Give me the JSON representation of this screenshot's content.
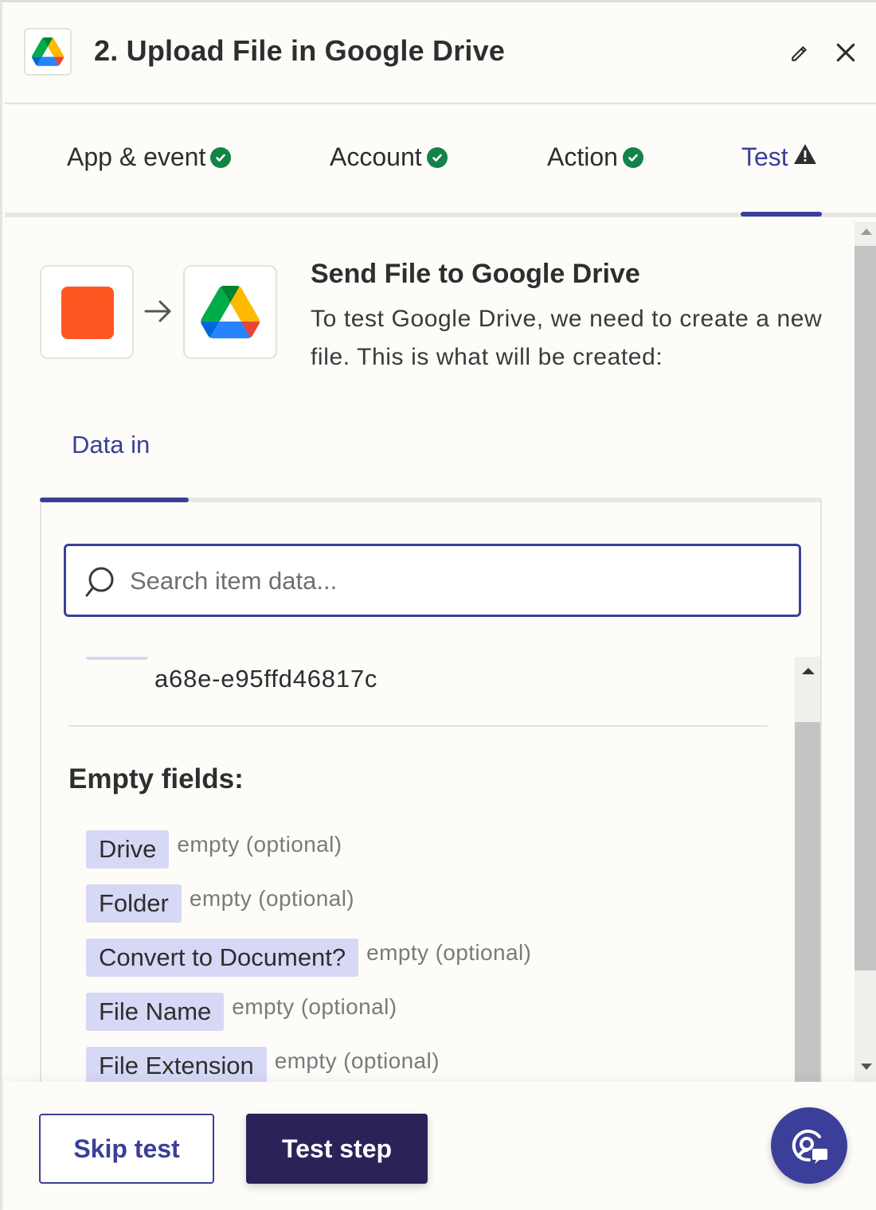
{
  "header": {
    "title": "2. Upload File in Google Drive",
    "app_icon": "google-drive-icon",
    "edit_icon": "pencil-icon",
    "close_icon": "close-icon"
  },
  "steps": [
    {
      "label": "App & event",
      "status": "complete"
    },
    {
      "label": "Account",
      "status": "complete"
    },
    {
      "label": "Action",
      "status": "complete"
    },
    {
      "label": "Test",
      "status": "warning",
      "active": true
    }
  ],
  "flow": {
    "title": "Send File to Google Drive",
    "description": "To test Google Drive, we need to create a new file. This is what will be created:",
    "source_color": "#ff5722"
  },
  "data_tab": {
    "label": "Data in"
  },
  "search": {
    "placeholder": "Search item data..."
  },
  "list": {
    "partial_value": "a68e-e95ffd46817c",
    "empty_heading": "Empty fields:",
    "empty_fields": [
      {
        "name": "Drive",
        "note": "empty (optional)"
      },
      {
        "name": "Folder",
        "note": "empty (optional)"
      },
      {
        "name": "Convert to Document?",
        "note": "empty (optional)"
      },
      {
        "name": "File Name",
        "note": "empty (optional)"
      },
      {
        "name": "File Extension",
        "note": "empty (optional)"
      }
    ]
  },
  "footer": {
    "skip_label": "Skip test",
    "test_label": "Test step",
    "help_icon": "support-chat-icon"
  },
  "colors": {
    "accent": "#3b3f99",
    "primary_button": "#2b2358",
    "success": "#138348",
    "chip": "#d6d8f5"
  }
}
